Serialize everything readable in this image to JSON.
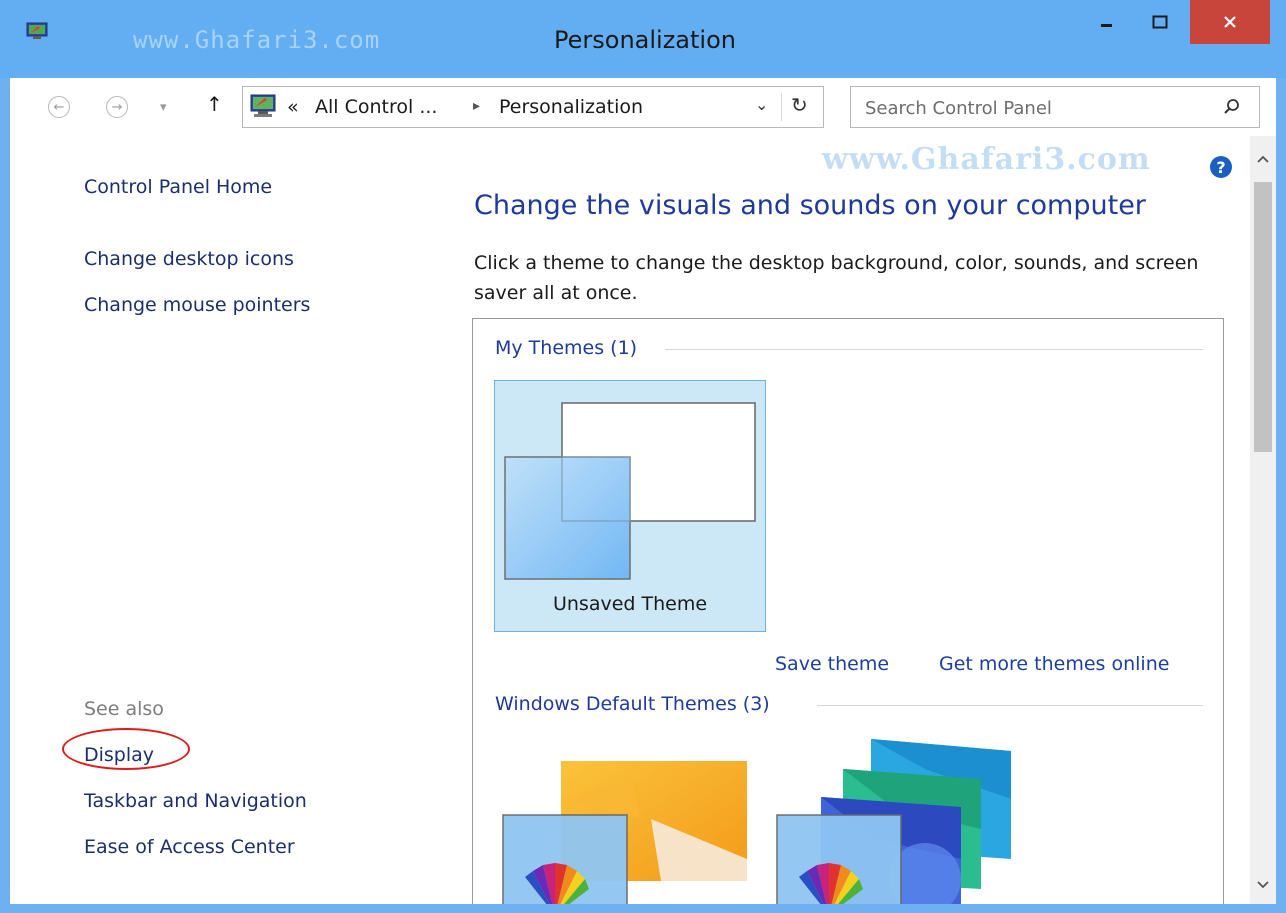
{
  "window": {
    "title": "Personalization",
    "watermark": "www.Ghafari3.com",
    "controls": {
      "minimize": "—",
      "maximize": "☐",
      "close": "✕"
    }
  },
  "nav": {
    "back_icon": "←",
    "forward_icon": "→",
    "recent_icon": "▾",
    "up_icon": "↑",
    "breadcrumb": {
      "separator_left": "«",
      "item1": "All Control ...",
      "arrow": "▸",
      "item2": "Personalization"
    },
    "dropdown_icon": "⌄",
    "refresh_icon": "↻",
    "search_placeholder": "Search Control Panel",
    "search_icon": "⚲"
  },
  "sidebar": {
    "home": "Control Panel Home",
    "links": [
      "Change desktop icons",
      "Change mouse pointers"
    ],
    "see_also_label": "See also",
    "see_also_links": [
      "Display",
      "Taskbar and Navigation",
      "Ease of Access Center"
    ]
  },
  "main": {
    "watermark": "www.Ghafari3.com",
    "help_icon": "?",
    "heading": "Change the visuals and sounds on your computer",
    "description": "Click a theme to change the desktop background, color, sounds, and screen saver all at once.",
    "my_themes_title": "My Themes (1)",
    "my_theme_name": "Unsaved Theme",
    "save_theme": "Save theme",
    "get_more": "Get more themes online",
    "default_themes_title": "Windows Default Themes (3)"
  },
  "colors": {
    "titlebar": "#63aef2",
    "close_button": "#c7453b",
    "link": "#1b2f6a",
    "heading": "#1e3a9b",
    "annotation_circle": "#e01b1b"
  }
}
